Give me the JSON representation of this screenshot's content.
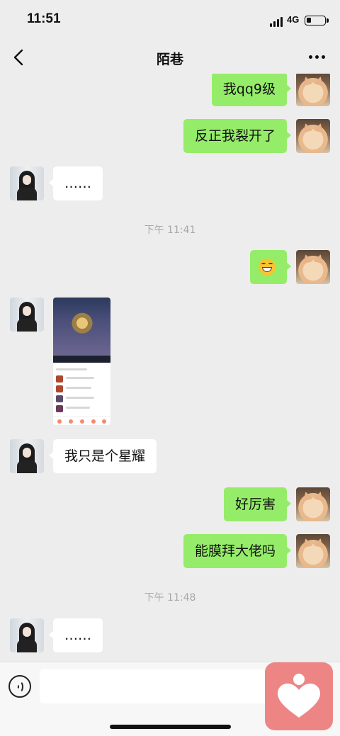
{
  "status_bar": {
    "time": "11:51",
    "network": "4G"
  },
  "nav": {
    "title": "陌巷"
  },
  "messages": [
    {
      "side": "right",
      "text": "我qq9级"
    },
    {
      "side": "right",
      "text": "反正我裂开了"
    },
    {
      "side": "left",
      "text": "……"
    },
    {
      "timestamp": "下午 11:41"
    },
    {
      "side": "right",
      "emoji": "grinning-face"
    },
    {
      "side": "left",
      "image": "game-rank-screenshot"
    },
    {
      "side": "left",
      "text": "我只是个星耀"
    },
    {
      "side": "right",
      "text": "好厉害"
    },
    {
      "side": "right",
      "text": "能膜拜大佬吗"
    },
    {
      "timestamp": "下午 11:48"
    },
    {
      "side": "left",
      "text": "……"
    }
  ],
  "colors": {
    "my_bubble": "#95ec69",
    "their_bubble": "#ffffff",
    "background": "#ededed",
    "app_logo": "#ee8585"
  }
}
